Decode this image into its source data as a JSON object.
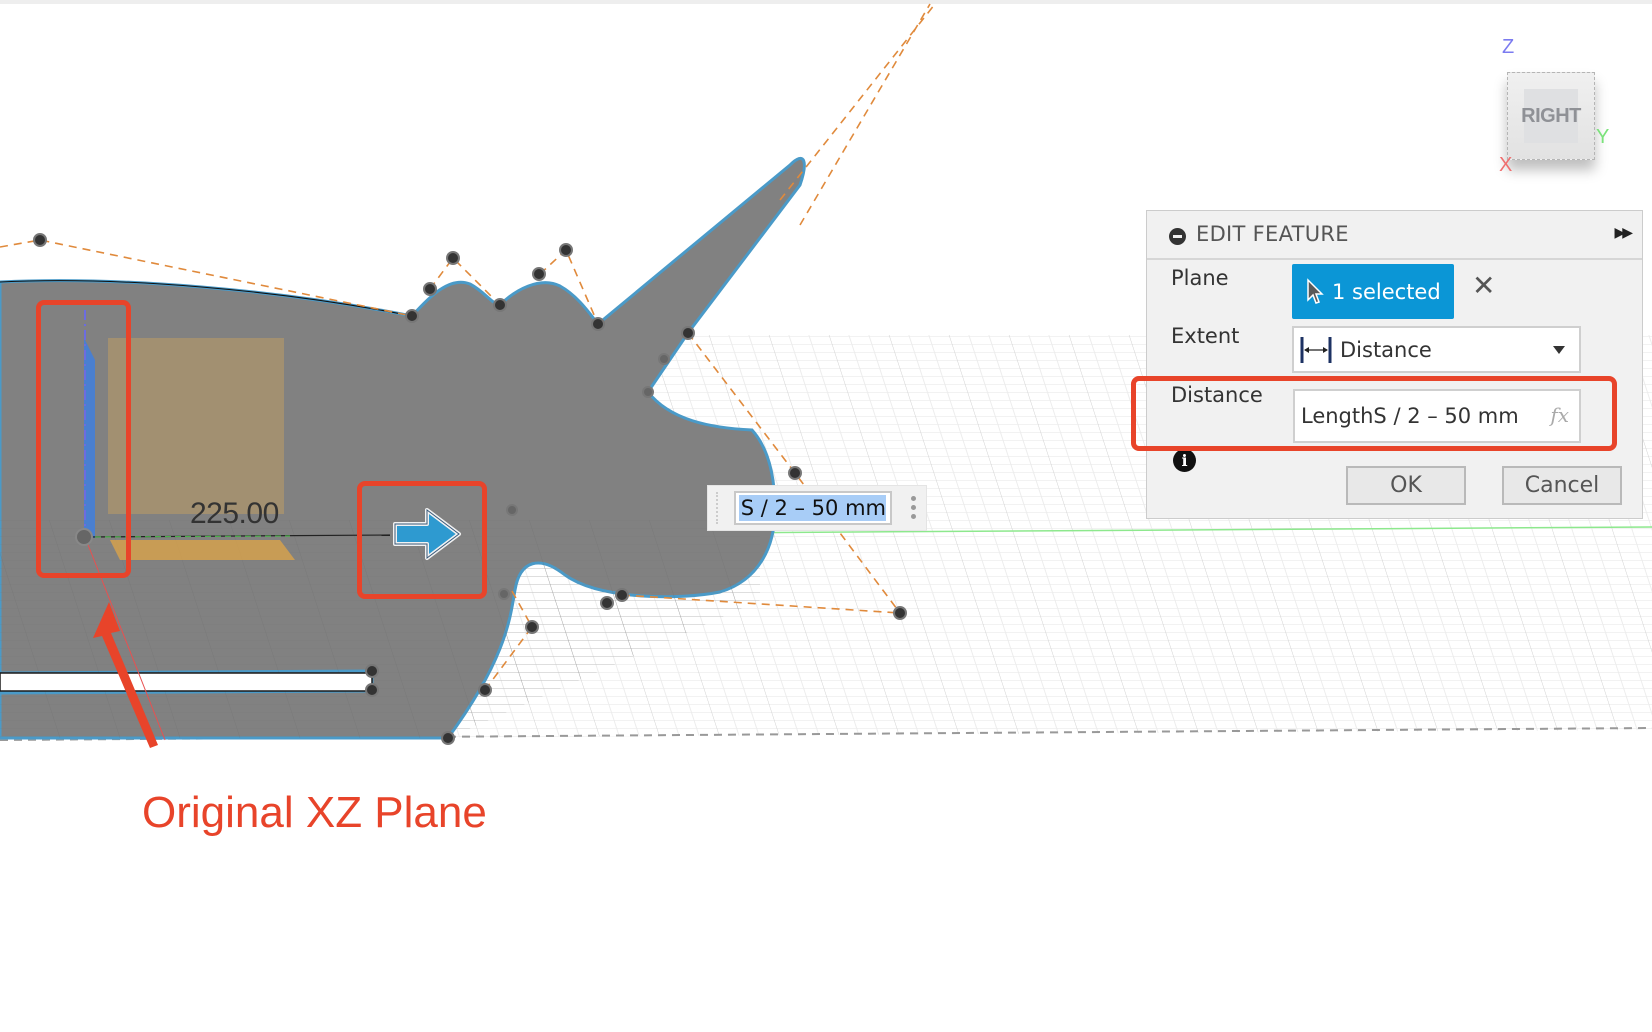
{
  "viewport": {
    "dimension_label": "225.00",
    "inline_input_value": "S / 2 – 50 mm",
    "colors": {
      "body_fill": "#818181",
      "sketch_outline": "#4a9ac8",
      "construction_line": "#e08a3c",
      "plane_blue": "#4a7fd0",
      "plane_highlight": "#c9a15d",
      "grid_line": "#d8d8d8",
      "y_axis_green": "#7be27b"
    }
  },
  "view_cube": {
    "face_label": "RIGHT",
    "axis_z": "Z",
    "axis_y": "Y",
    "axis_x": "X"
  },
  "edit_feature": {
    "title": "EDIT FEATURE",
    "collapse_icon": "minus-circle-icon",
    "expand_icon": "fast-forward-icon",
    "plane_label": "Plane",
    "plane_selection": "1 selected",
    "extent_label": "Extent",
    "extent_value": "Distance",
    "distance_label": "Distance",
    "distance_value": "LengthS / 2 – 50 mm",
    "fx_label": "fx",
    "ok_label": "OK",
    "cancel_label": "Cancel",
    "selection_color": "#0b96d6"
  },
  "annotations": {
    "caption": "Original XZ Plane",
    "color": "#e8442a"
  }
}
